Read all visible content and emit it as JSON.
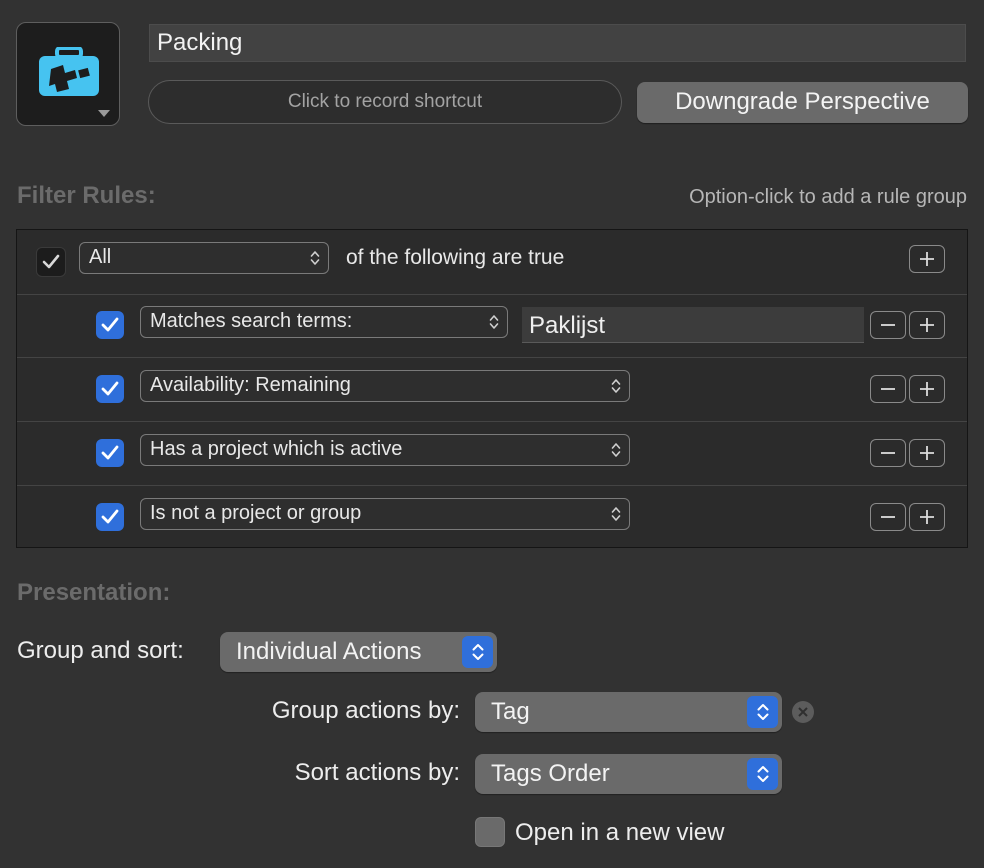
{
  "perspective": {
    "name": "Packing",
    "icon": "suitcase-icon"
  },
  "shortcut": {
    "label": "Click to record shortcut"
  },
  "downgrade_button": {
    "label": "Downgrade Perspective"
  },
  "filter_rules": {
    "title": "Filter Rules:",
    "hint": "Option-click to add a rule group",
    "root": {
      "checked": true,
      "quantifier": "All",
      "suffix": "of the following are true"
    },
    "rules": [
      {
        "checked": true,
        "condition": "Matches search terms:",
        "value": "Paklijst"
      },
      {
        "checked": true,
        "condition": "Availability: Remaining"
      },
      {
        "checked": true,
        "condition": "Has a project which is active"
      },
      {
        "checked": true,
        "condition": "Is not a project or group"
      }
    ]
  },
  "presentation": {
    "title": "Presentation:",
    "group_and_sort": {
      "label": "Group and sort:",
      "value": "Individual Actions"
    },
    "group_by": {
      "label": "Group actions by:",
      "value": "Tag"
    },
    "sort_by": {
      "label": "Sort actions by:",
      "value": "Tags Order"
    },
    "open_new_view": {
      "label": "Open in a new view",
      "checked": false
    }
  },
  "colors": {
    "background": "#323232",
    "accent_blue": "#2f6fdb",
    "icon_cyan": "#46c3f0"
  }
}
